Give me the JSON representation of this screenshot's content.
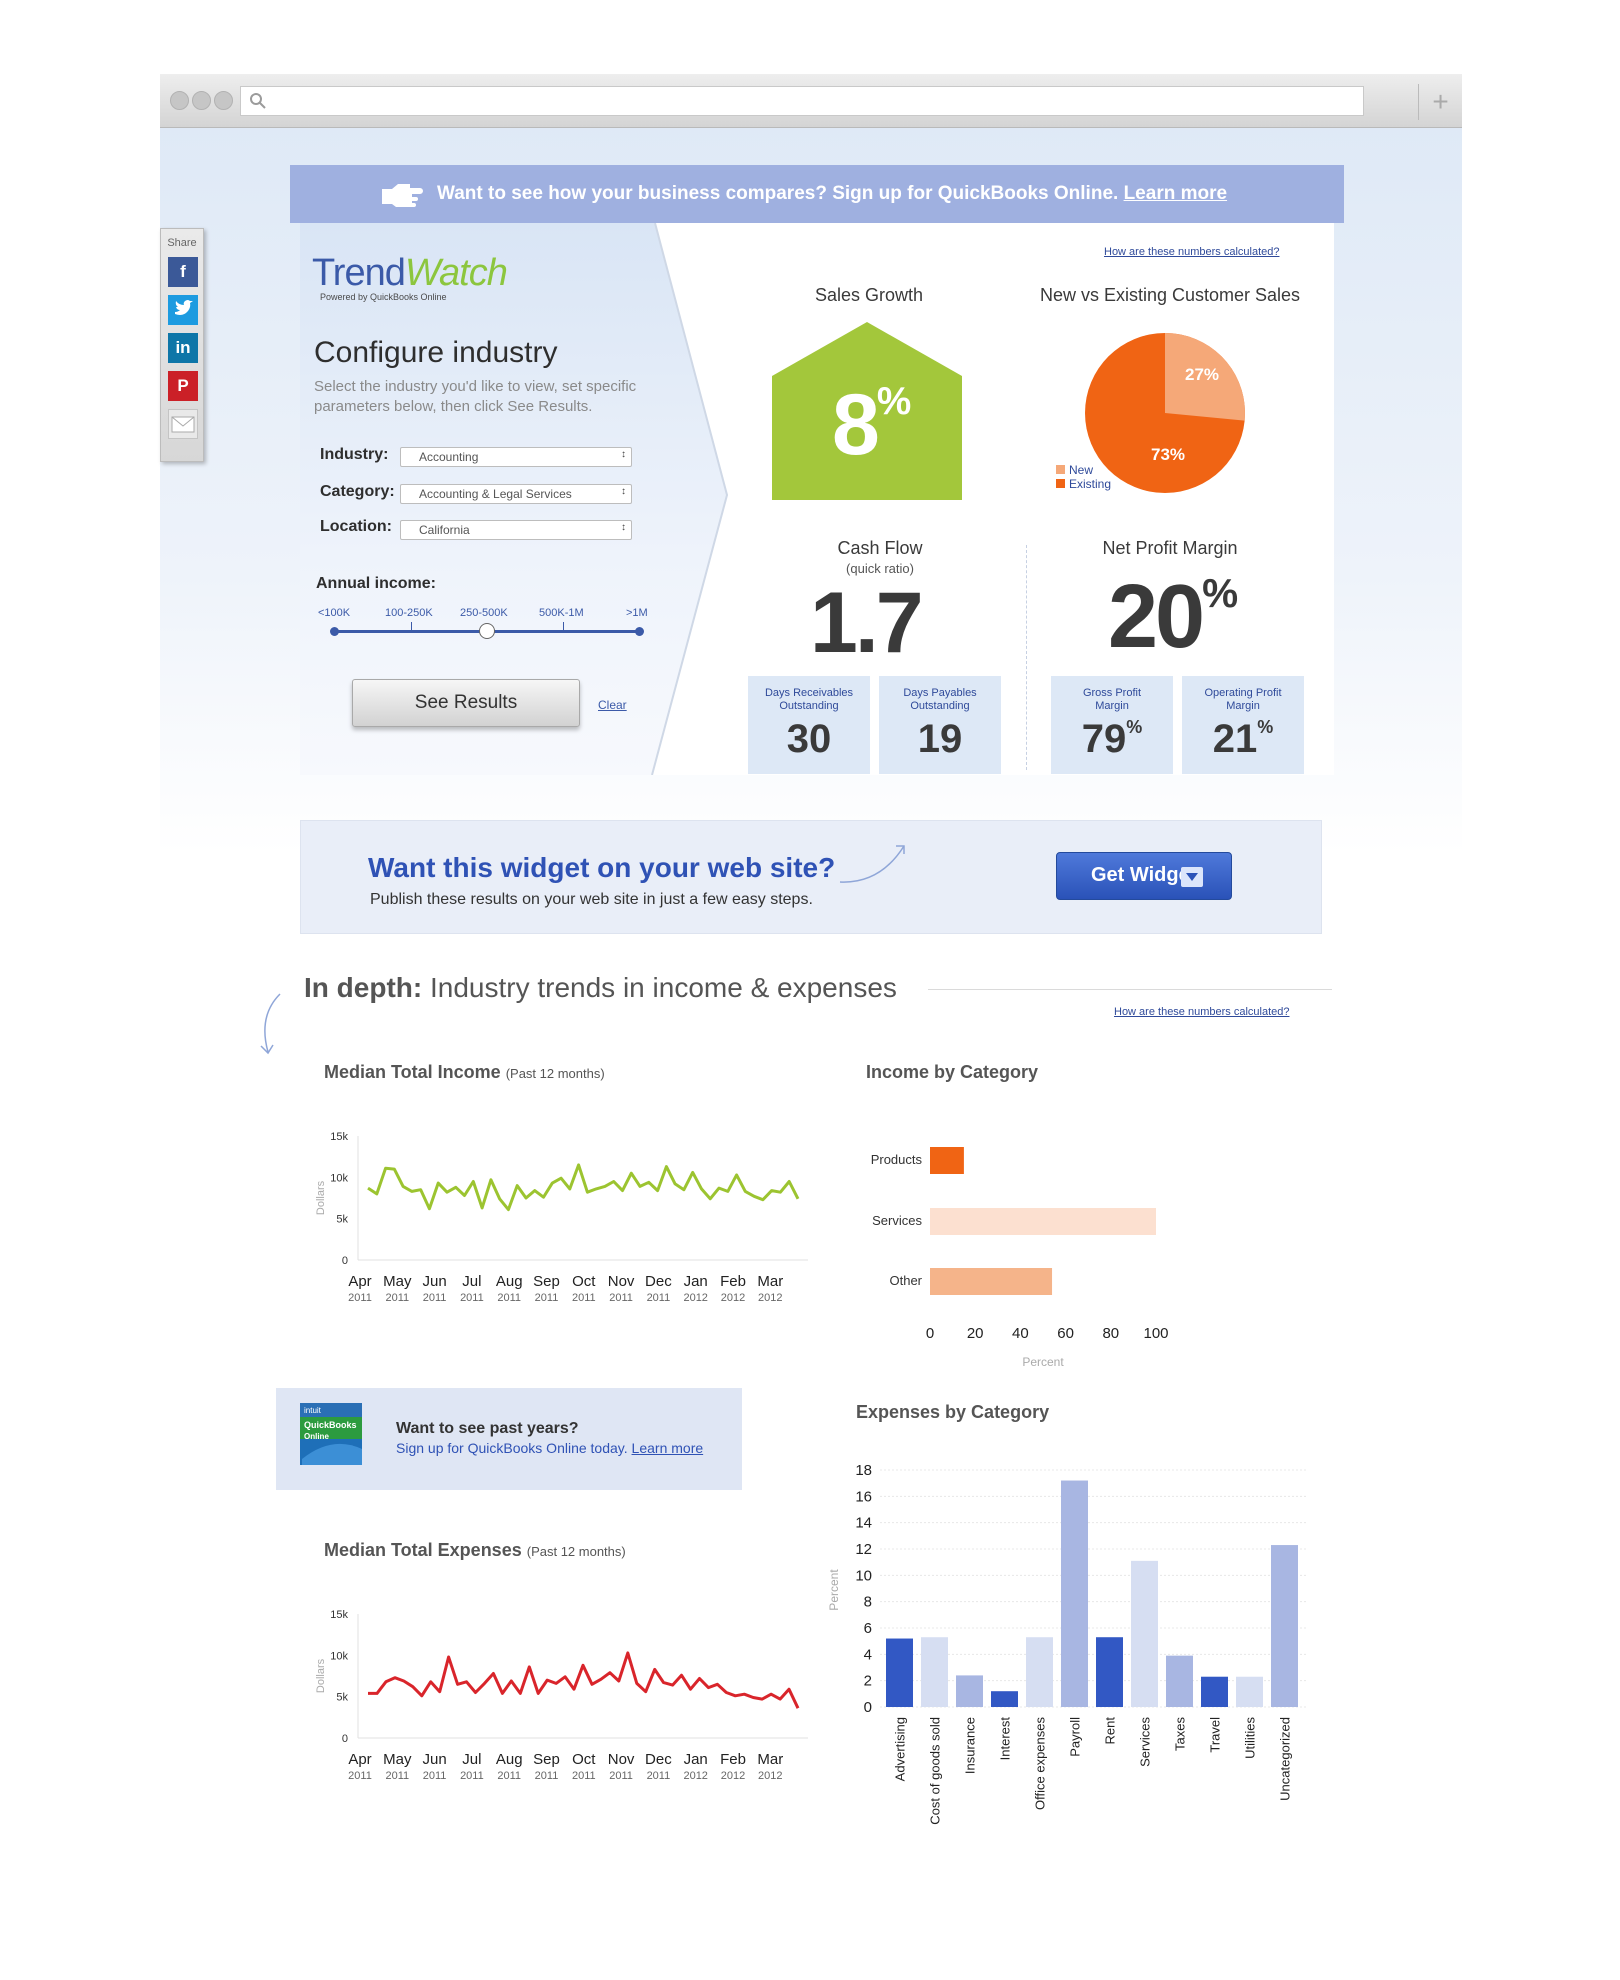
{
  "banner": {
    "text": "Want to see how your business compares? Sign up for QuickBooks Online.",
    "link": "Learn more"
  },
  "share": {
    "label": "Share",
    "icons": [
      "facebook-icon",
      "twitter-icon",
      "linkedin-icon",
      "pinterest-icon",
      "email-icon"
    ]
  },
  "logo": {
    "part1": "Trend",
    "part2": "Watch",
    "sub": "Powered by QuickBooks Online"
  },
  "configure": {
    "title": "Configure industry",
    "description": "Select the industry you'd like to view, set specific parameters below, then click See Results.",
    "industry_label": "Industry:",
    "industry_value": "Accounting",
    "category_label": "Category:",
    "category_value": "Accounting & Legal Services",
    "location_label": "Location:",
    "location_value": "California",
    "income_label": "Annual income:",
    "income_ticks": [
      "<100K",
      "100-250K",
      "250-500K",
      "500K-1M",
      ">1M"
    ],
    "income_selected": "250-500K",
    "see_results": "See Results",
    "clear": "Clear"
  },
  "metrics": {
    "how_link": "How are these numbers calculated?",
    "sales_growth": {
      "title": "Sales Growth",
      "value": "8",
      "unit": "%"
    },
    "customer_sales": {
      "title": "New vs Existing Customer Sales",
      "new_label": "New",
      "new_value": "27%",
      "existing_label": "Existing",
      "existing_value": "73%",
      "new_color": "#f5a878",
      "existing_color": "#f06414"
    },
    "cash_flow": {
      "title": "Cash Flow",
      "subtitle": "(quick ratio)",
      "value": "1.7"
    },
    "net_profit": {
      "title": "Net Profit Margin",
      "value": "20",
      "unit": "%"
    },
    "dro": {
      "label": "Days Receivables Outstanding",
      "value": "30"
    },
    "dpo": {
      "label": "Days Payables Outstanding",
      "value": "19"
    },
    "gross": {
      "label": "Gross Profit Margin",
      "value": "79",
      "unit": "%"
    },
    "operating": {
      "label": "Operating Profit Margin",
      "value": "21",
      "unit": "%"
    }
  },
  "widget_promo": {
    "title": "Want this widget on your web site?",
    "subtitle": "Publish these results on your web site in just a few easy steps.",
    "button": "Get Widget!"
  },
  "in_depth": {
    "bold": "In depth:",
    "rest": "Industry trends in income & expenses",
    "how_link": "How are these numbers calculated?"
  },
  "past_promo": {
    "title": "Want to see past years?",
    "subtitle": "Sign up for QuickBooks Online today.",
    "link": "Learn more",
    "logo_top": "intuit",
    "logo_mid": "QuickBooks",
    "logo_bot": "Online"
  },
  "chart_data": [
    {
      "type": "line",
      "title": "Median Total Income",
      "subtitle": "(Past 12 months)",
      "ylabel": "Dollars",
      "ylim": [
        0,
        15000
      ],
      "yticks": [
        "0",
        "5k",
        "10k",
        "15k"
      ],
      "months": [
        "Apr",
        "May",
        "Jun",
        "Jul",
        "Aug",
        "Sep",
        "Oct",
        "Nov",
        "Dec",
        "Jan",
        "Feb",
        "Mar"
      ],
      "years": [
        "2011",
        "2011",
        "2011",
        "2011",
        "2011",
        "2011",
        "2011",
        "2011",
        "2011",
        "2012",
        "2012",
        "2012"
      ],
      "color": "#9cc430",
      "values": [
        8700,
        8000,
        11100,
        11000,
        8900,
        8300,
        8500,
        6200,
        9300,
        8200,
        8800,
        7800,
        9500,
        6300,
        9700,
        7400,
        6100,
        9000,
        7500,
        8400,
        7600,
        9300,
        9900,
        8600,
        11500,
        8200,
        8600,
        8900,
        9500,
        8400,
        10500,
        8900,
        9400,
        8400,
        11300,
        9200,
        8500,
        10600,
        8600,
        7400,
        8700,
        8300,
        10300,
        8300,
        7700,
        7300,
        8400,
        8200,
        9500,
        7400
      ]
    },
    {
      "type": "line",
      "title": "Median Total Expenses",
      "subtitle": "(Past 12 months)",
      "ylabel": "Dollars",
      "ylim": [
        0,
        15000
      ],
      "yticks": [
        "0",
        "5k",
        "10k",
        "15k"
      ],
      "months": [
        "Apr",
        "May",
        "Jun",
        "Jul",
        "Aug",
        "Sep",
        "Oct",
        "Nov",
        "Dec",
        "Jan",
        "Feb",
        "Mar"
      ],
      "years": [
        "2011",
        "2011",
        "2011",
        "2011",
        "2011",
        "2011",
        "2011",
        "2011",
        "2011",
        "2012",
        "2012",
        "2012"
      ],
      "color": "#d9252b",
      "values": [
        5400,
        5400,
        6800,
        7300,
        6900,
        6200,
        5100,
        6800,
        5600,
        9800,
        6500,
        6800,
        5500,
        6600,
        7800,
        5400,
        6900,
        5400,
        8600,
        5400,
        7000,
        6600,
        7400,
        5900,
        8800,
        6500,
        7100,
        7900,
        6900,
        10300,
        6600,
        5600,
        8300,
        6700,
        6400,
        7600,
        5900,
        7200,
        6100,
        6500,
        5500,
        5100,
        5300,
        4900,
        4700,
        5300,
        4700,
        5900,
        3600
      ]
    },
    {
      "type": "bar",
      "orientation": "horizontal",
      "title": "Income by Category",
      "xlabel": "Percent",
      "xlim": [
        0,
        100
      ],
      "xticks": [
        "0",
        "20",
        "40",
        "60",
        "80",
        "100"
      ],
      "categories": [
        "Products",
        "Services",
        "Other"
      ],
      "values": [
        15,
        100,
        54
      ],
      "colors": [
        "#f06414",
        "#fce0d0",
        "#f5b48a"
      ]
    },
    {
      "type": "bar",
      "title": "Expenses by Category",
      "ylabel": "Percent",
      "ylim": [
        0,
        18
      ],
      "yticks": [
        "0",
        "2",
        "4",
        "6",
        "8",
        "10",
        "12",
        "14",
        "16",
        "18"
      ],
      "categories": [
        "Advertising",
        "Cost of goods sold",
        "Insurance",
        "Interest",
        "Office expenses",
        "Payroll",
        "Rent",
        "Services",
        "Taxes",
        "Travel",
        "Utilities",
        "Uncategorized"
      ],
      "values": [
        5.2,
        5.3,
        2.4,
        1.2,
        5.3,
        17.2,
        5.3,
        11.1,
        3.9,
        2.3,
        2.3,
        12.3
      ],
      "colors": [
        "#3258c4",
        "#d6def2",
        "#a8b6e2",
        "#3258c4",
        "#d6def2",
        "#a8b6e2",
        "#3258c4",
        "#d6def2",
        "#a8b6e2",
        "#3258c4",
        "#d6def2",
        "#a8b6e2"
      ]
    }
  ]
}
